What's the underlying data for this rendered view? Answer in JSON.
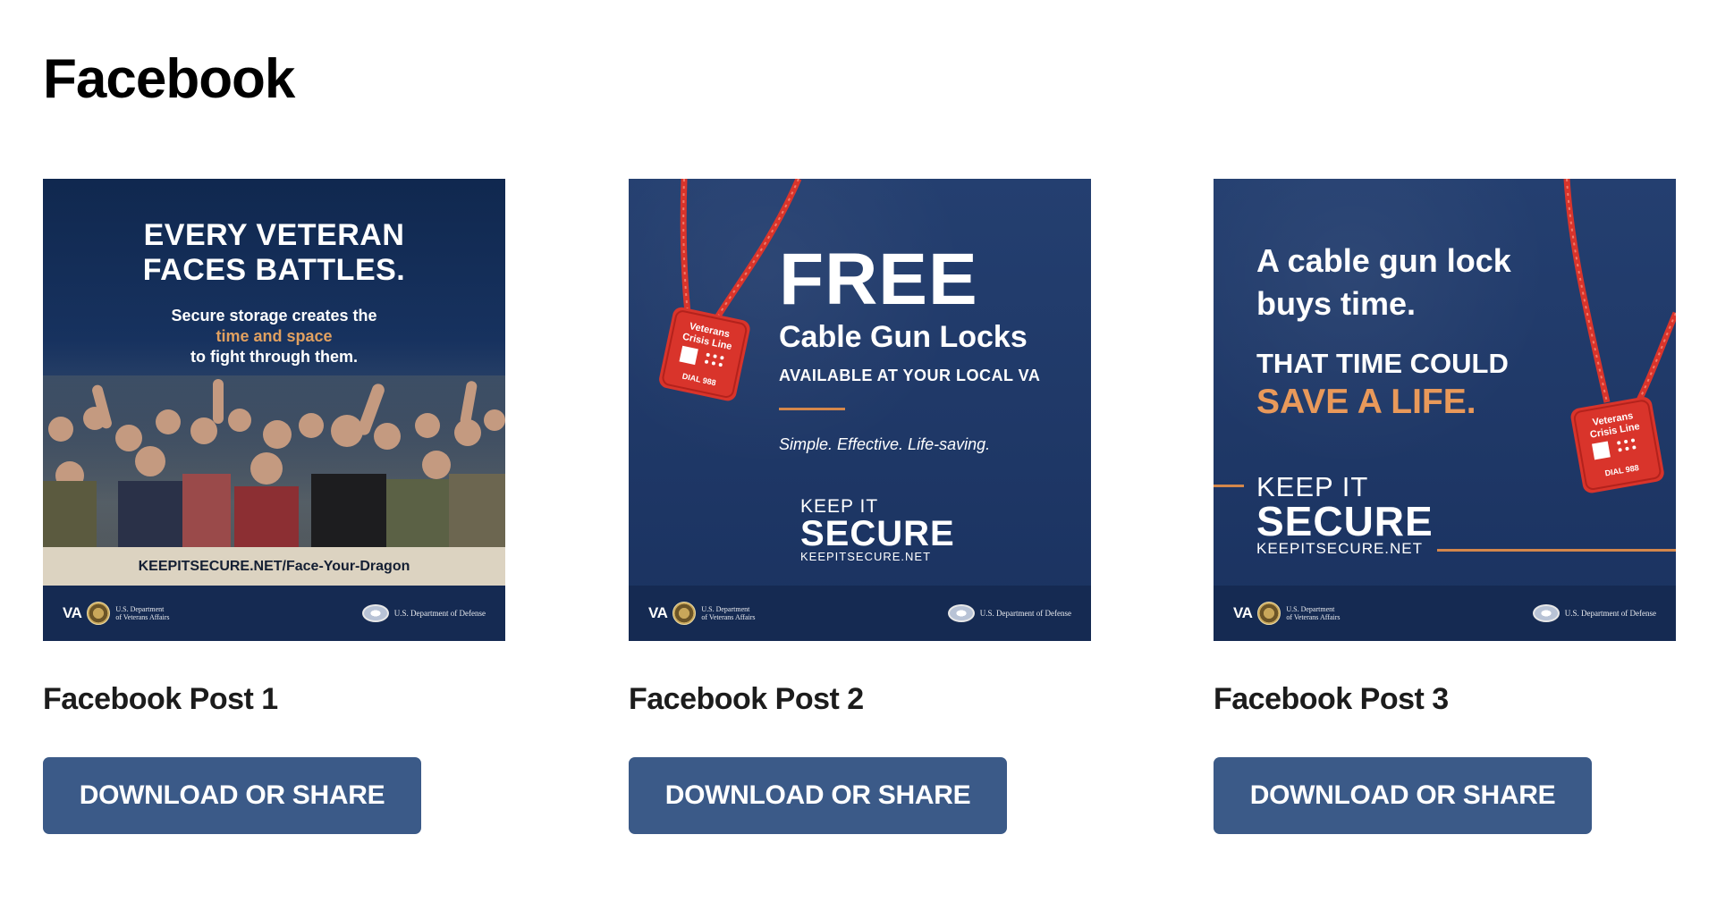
{
  "page": {
    "section_title": "Facebook"
  },
  "cards": [
    {
      "title": "Facebook Post 1",
      "button_label": "DOWNLOAD OR SHARE",
      "poster": {
        "headline_1": "EVERY VETERAN",
        "headline_2": "FACES BATTLES.",
        "sub_1": "Secure storage creates the",
        "sub_accent": "time and space",
        "sub_2": "to fight through them.",
        "url": "KEEPITSECURE.NET/Face-Your-Dragon",
        "va_logo": "VA",
        "va_dept_1": "U.S. Department",
        "va_dept_2": "of Veterans Affairs",
        "dod_text": "U.S. Department of Defense"
      }
    },
    {
      "title": "Facebook Post 2",
      "button_label": "DOWNLOAD OR SHARE",
      "poster": {
        "headline": "FREE",
        "line_2": "Cable Gun Locks",
        "line_3": "AVAILABLE AT YOUR LOCAL VA",
        "tagline": "Simple. Effective. Life-saving.",
        "keep": "KEEP IT",
        "secure": "SECURE",
        "net": "KEEPITSECURE.NET",
        "lock_label_1": "Veterans",
        "lock_label_2": "Crisis Line",
        "lock_label_3": "DIAL 988",
        "va_logo": "VA",
        "va_dept_1": "U.S. Department",
        "va_dept_2": "of Veterans Affairs",
        "dod_text": "U.S. Department of Defense"
      }
    },
    {
      "title": "Facebook Post 3",
      "button_label": "DOWNLOAD OR SHARE",
      "poster": {
        "quote_1a": "A cable gun lock",
        "quote_1b": "buys time.",
        "quote_2": "THAT TIME COULD",
        "quote_3": "SAVE A LIFE.",
        "keep": "KEEP IT",
        "secure": "SECURE",
        "net": "KEEPITSECURE.NET",
        "lock_label_1": "Veterans",
        "lock_label_2": "Crisis Line",
        "lock_label_3": "DIAL 988",
        "va_logo": "VA",
        "va_dept_1": "U.S. Department",
        "va_dept_2": "of Veterans Affairs",
        "dod_text": "U.S. Department of Defense"
      }
    }
  ],
  "colors": {
    "button_bg": "#3b5a88",
    "poster_navy": "#1e3765",
    "accent_orange": "#d4874b",
    "lock_red": "#d9342b"
  }
}
